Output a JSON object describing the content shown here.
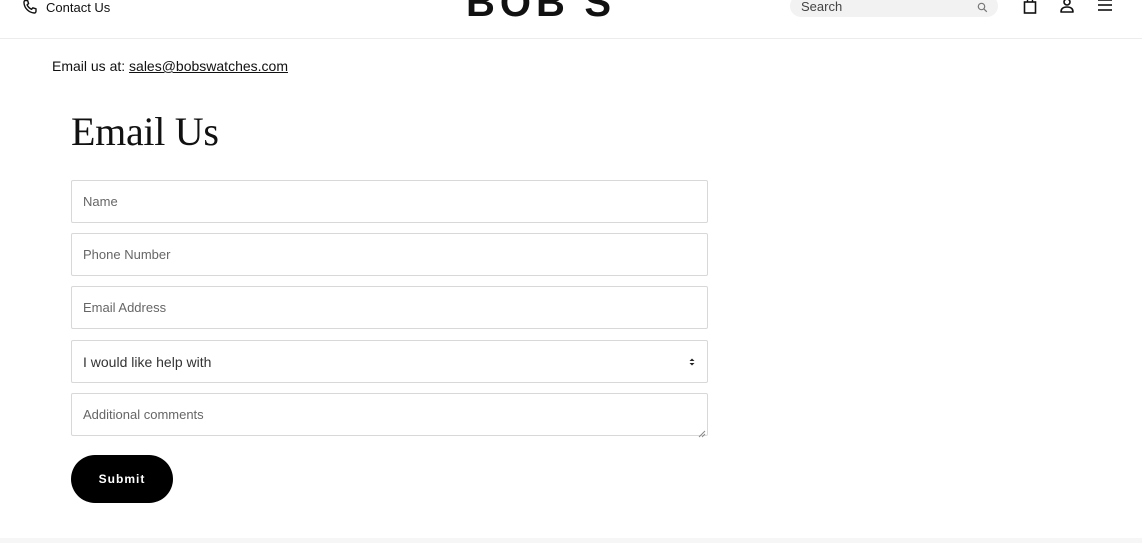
{
  "header": {
    "contact_label": "Contact Us",
    "logo_text": "BOB'S",
    "search": {
      "placeholder": "Search"
    },
    "icons": [
      "phone-icon",
      "search-icon",
      "bag-icon",
      "account-icon",
      "menu-icon"
    ]
  },
  "main": {
    "email_prefix": "Email us at:",
    "email_link": "sales@bobswatches.com",
    "title": "Email Us",
    "form": {
      "name_placeholder": "Name",
      "phone_placeholder": "Phone Number",
      "email_placeholder": "Email Address",
      "help_select": "I would like help with",
      "comments_placeholder": "Additional comments",
      "submit_label": "Submit"
    }
  },
  "colors": {
    "background": "#ffffff",
    "text": "#111111",
    "button": "#000000",
    "button_text": "#ffffff",
    "search_bg": "#f2f2f2",
    "field_border": "#d8d8d8"
  }
}
